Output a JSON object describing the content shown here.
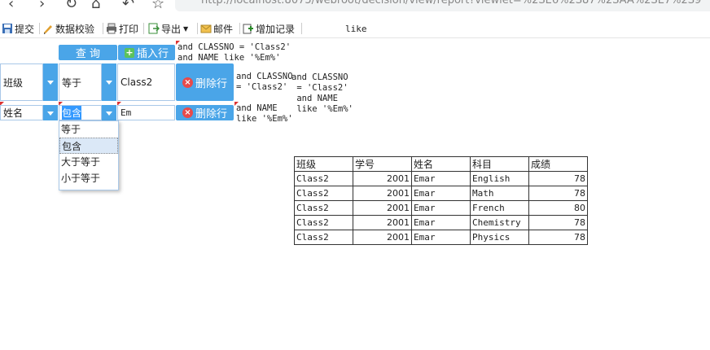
{
  "browser": {
    "url": "http://localhost:8075/webroot/decision/view/report?viewlet=%2SE6%2S87%2SAA%2SE7%2S9"
  },
  "toolbar": {
    "submit": "提交",
    "validate": "数据校验",
    "print": "打印",
    "export": "导出",
    "mail": "邮件",
    "add_record": "增加记录",
    "extra_text": "like"
  },
  "buttons": {
    "query": "查 询",
    "insert_row": "插入行",
    "delete_row": "删除行"
  },
  "sql": {
    "top": "and CLASSNO = 'Class2'\nand NAME like '%Em%'",
    "row1_a": "and CLASSNO\n= 'Class2'",
    "row1_b": "and CLASSNO\n = 'Class2'\n and NAME\n like '%Em%'",
    "row2_a": "and NAME\nlike '%Em%'"
  },
  "filters": [
    {
      "field": "班级",
      "operator": "等于",
      "value": "Class2"
    },
    {
      "field": "姓名",
      "operator": "包含",
      "value": "Em"
    }
  ],
  "dropdown_options": [
    {
      "label": "等于"
    },
    {
      "label": "包含"
    },
    {
      "label": "大于等于"
    },
    {
      "label": "小于等于"
    }
  ],
  "table": {
    "headers": [
      "班级",
      "学号",
      "姓名",
      "科目",
      "成绩"
    ],
    "rows": [
      [
        "Class2",
        "2001",
        "Emar",
        "English",
        "78"
      ],
      [
        "Class2",
        "2001",
        "Emar",
        "Math",
        "78"
      ],
      [
        "Class2",
        "2001",
        "Emar",
        "French",
        "80"
      ],
      [
        "Class2",
        "2001",
        "Emar",
        "Chemistry",
        "78"
      ],
      [
        "Class2",
        "2001",
        "Emar",
        "Physics",
        "78"
      ]
    ]
  },
  "colors": {
    "accent": "#4aa5e8",
    "delete": "#e84a4a",
    "insert": "#5cc25c"
  }
}
